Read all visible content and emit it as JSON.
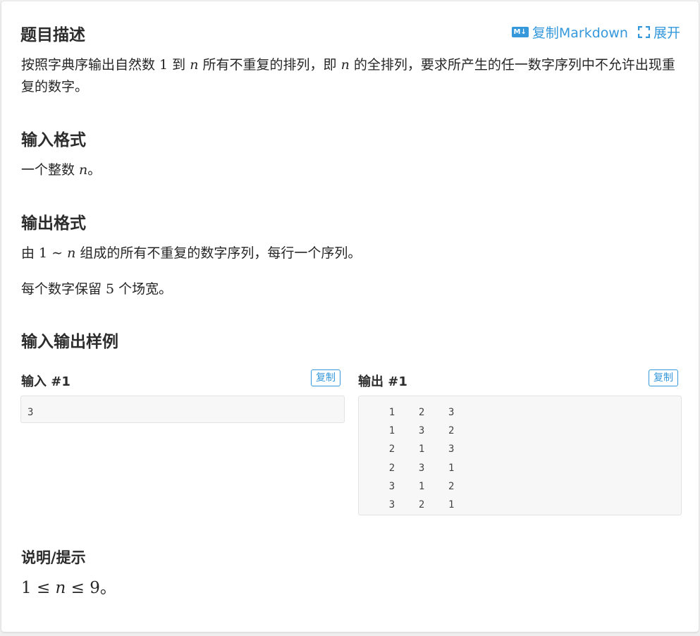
{
  "description": {
    "title": "题目描述",
    "copy_markdown_label": "复制Markdown",
    "expand_label": "展开",
    "text_part1": "按照字典序输出自然数 ",
    "text_num1": "1",
    "text_part2": " 到 ",
    "text_var1": "n",
    "text_part3": " 所有不重复的排列，即 ",
    "text_var2": "n",
    "text_part4": " 的全排列，要求所产生的任一数字序列中不允许出现重复的数字。"
  },
  "input_format": {
    "title": "输入格式",
    "text_part1": "一个整数 ",
    "text_var": "n",
    "text_part2": "。"
  },
  "output_format": {
    "title": "输出格式",
    "line1_part1": "由 ",
    "line1_math": "1 ∼ ",
    "line1_var": "n",
    "line1_part2": " 组成的所有不重复的数字序列，每行一个序列。",
    "line2_part1": "每个数字保留 ",
    "line2_num": "5",
    "line2_part2": " 个场宽。"
  },
  "samples": {
    "title": "输入输出样例",
    "input_label": "输入 #1",
    "output_label": "输出 #1",
    "copy_label": "复制",
    "input_text": "3",
    "output_text": "    1    2    3\n    1    3    2\n    2    1    3\n    2    3    1\n    3    1    2\n    3    2    1"
  },
  "hint": {
    "title": "说明/提示",
    "math_left": "1 ≤ ",
    "var": "n",
    "math_right": " ≤ 9",
    "suffix": "。"
  },
  "colors": {
    "accent": "#3498db",
    "code_bg": "#f7f7f7",
    "page_bg": "#efefef"
  },
  "icons": [
    "markdown-icon",
    "expand-icon"
  ]
}
